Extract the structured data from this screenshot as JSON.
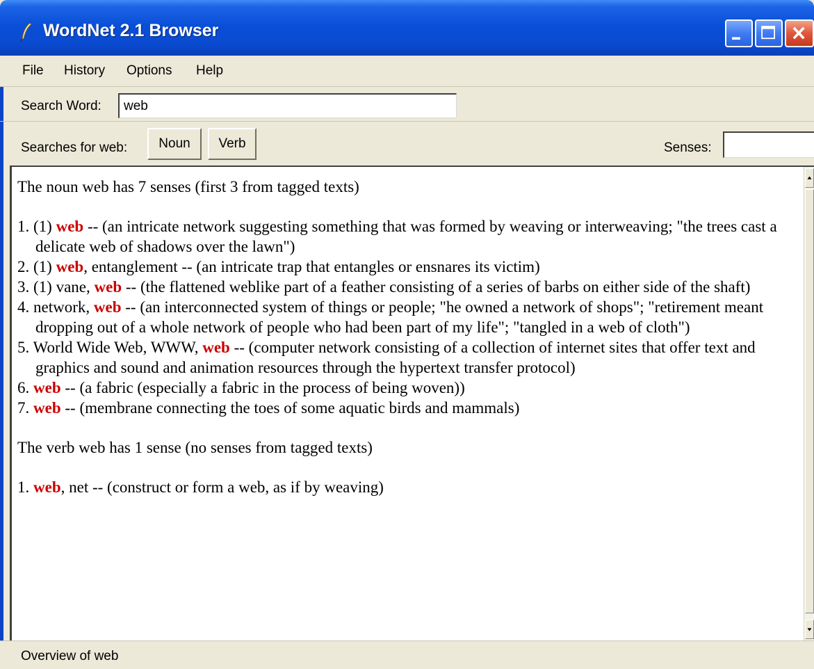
{
  "window": {
    "title": "WordNet 2.1 Browser",
    "icons": [
      "quill-icon",
      "minimize-icon",
      "maximize-icon",
      "close-icon"
    ]
  },
  "menu": {
    "items": [
      "File",
      "History",
      "Options",
      "Help"
    ]
  },
  "search": {
    "label": "Search Word:",
    "value": "web"
  },
  "searches": {
    "label": "Searches for web:",
    "buttons": [
      "Noun",
      "Verb"
    ],
    "senses_label": "Senses:",
    "senses_value": ""
  },
  "results": {
    "noun_header": "The noun web has 7 senses (first 3 from tagged texts)",
    "noun_senses": [
      {
        "prefix": "1. (1) ",
        "head": "web",
        "rest": " -- (an intricate network suggesting something that was formed by weaving or interweaving; \"the trees cast a delicate web of shadows over the lawn\")"
      },
      {
        "prefix": "2. (1) ",
        "head": "web",
        "rest": ", entanglement -- (an intricate trap that entangles or ensnares its victim)"
      },
      {
        "prefix": "3. (1) vane, ",
        "head": "web",
        "rest": " -- (the flattened weblike part of a feather consisting of a series of barbs on either side of the shaft)"
      },
      {
        "prefix": "4. network, ",
        "head": "web",
        "rest": " -- (an interconnected system of things or people; \"he owned a network of shops\"; \"retirement meant dropping out of a whole network of people who had been part of my life\"; \"tangled in a web of cloth\")"
      },
      {
        "prefix": "5. World Wide Web, WWW, ",
        "head": "web",
        "rest": " -- (computer network consisting of a collection of internet sites that offer text and graphics and sound and animation resources through the hypertext transfer protocol)"
      },
      {
        "prefix": "6. ",
        "head": "web",
        "rest": " -- (a fabric (especially a fabric in the process of being woven))"
      },
      {
        "prefix": "7. ",
        "head": "web",
        "rest": " -- (membrane connecting the toes of some aquatic birds and mammals)"
      }
    ],
    "verb_header": "The verb web has 1 sense (no senses from tagged texts)",
    "verb_senses": [
      {
        "prefix": "1. ",
        "head": "web",
        "rest": ", net -- (construct or form a web, as if by weaving)"
      }
    ],
    "highlight_color": "#cc0000"
  },
  "status": {
    "text": "Overview of web"
  }
}
